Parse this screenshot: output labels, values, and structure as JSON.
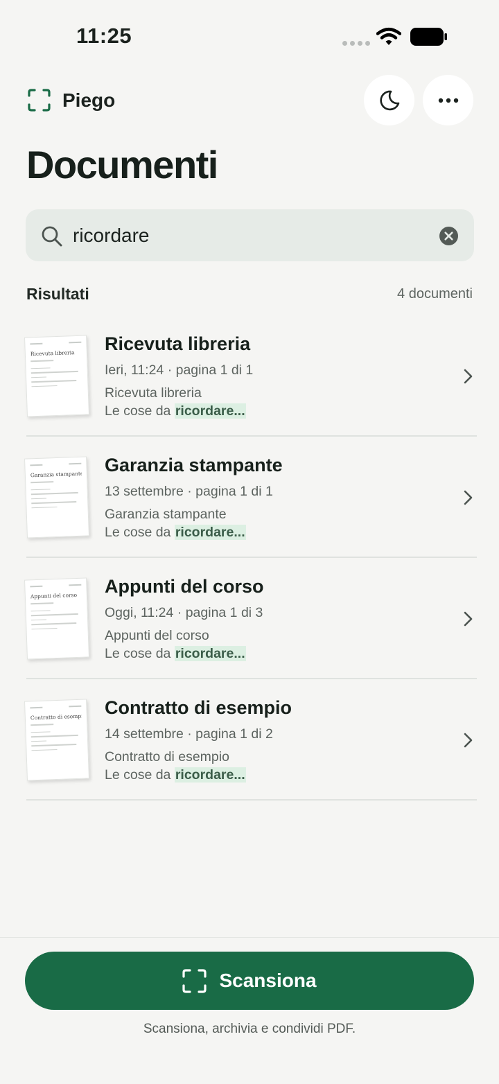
{
  "status": {
    "time": "11:25"
  },
  "app": {
    "name": "Piego"
  },
  "page": {
    "title": "Documenti"
  },
  "search": {
    "value": "ricordare",
    "placeholder": ""
  },
  "results": {
    "label": "Risultati",
    "count": "4 documenti"
  },
  "documents": [
    {
      "title": "Ricevuta libreria",
      "meta": "Ieri, 11:24 · pagina 1 di 1",
      "name": "Ricevuta libreria",
      "snippet_prefix": "Le cose da ",
      "snippet_match": "ricordare..."
    },
    {
      "title": "Garanzia stampante",
      "meta": "13 settembre · pagina 1 di 1",
      "name": "Garanzia stampante",
      "snippet_prefix": "Le cose da ",
      "snippet_match": "ricordare..."
    },
    {
      "title": "Appunti del corso",
      "meta": "Oggi, 11:24 · pagina 1 di 3",
      "name": "Appunti del corso",
      "snippet_prefix": "Le cose da ",
      "snippet_match": "ricordare..."
    },
    {
      "title": "Contratto di esempio",
      "meta": "14 settembre · pagina 1 di 2",
      "name": "Contratto di esempio",
      "snippet_prefix": "Le cose da ",
      "snippet_match": "ricordare..."
    }
  ],
  "bottom": {
    "scan_label": "Scansiona",
    "tagline": "Scansiona, archivia e condividi PDF."
  },
  "icons": {
    "brand": "scan-frame-icon",
    "theme": "moon-icon",
    "more": "ellipsis-icon",
    "search": "search-icon",
    "clear": "clear-icon",
    "chevron": "chevron-right-icon"
  },
  "colors": {
    "accent": "#196b46",
    "background": "#f5f5f3",
    "search_bg": "#e6ebe7",
    "highlight": "#dcefe2"
  }
}
